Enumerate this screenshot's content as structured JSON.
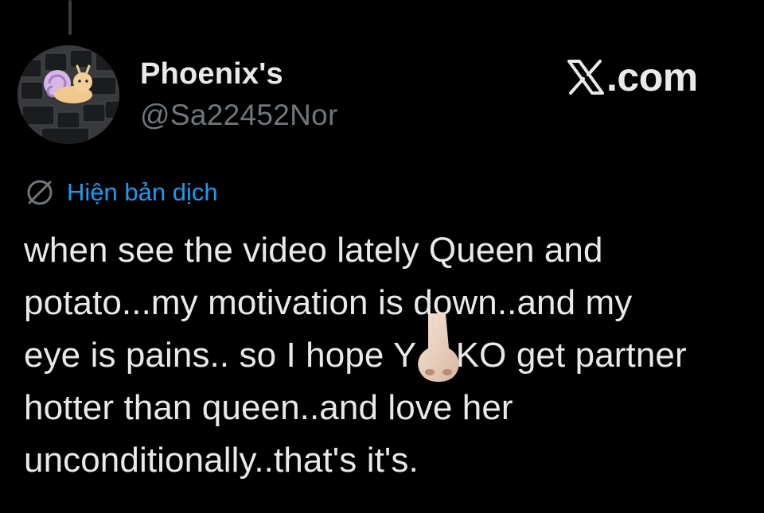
{
  "author": {
    "display_name": "Phoenix's",
    "handle": "@Sa22452Nor",
    "avatar": "snail-plushie-on-keyboard"
  },
  "brand": {
    "domain": ".com",
    "icon": "x-logo-icon"
  },
  "translate": {
    "icon": "globe-icon",
    "label": "Hiện bản dịch",
    "color": "#1d9bf0"
  },
  "tweet": {
    "lines": [
      "when see the video lately Queen and",
      "potato...my motivation is down..and my",
      "eye is pains.. so I hope Y    KO get partner",
      "hotter than queen..and love her",
      "unconditionally..that's it's."
    ],
    "emoji": "nose"
  },
  "colors": {
    "background": "#000000",
    "text_primary": "#e7e9ea",
    "text_secondary": "#71767b",
    "accent": "#1d9bf0"
  }
}
